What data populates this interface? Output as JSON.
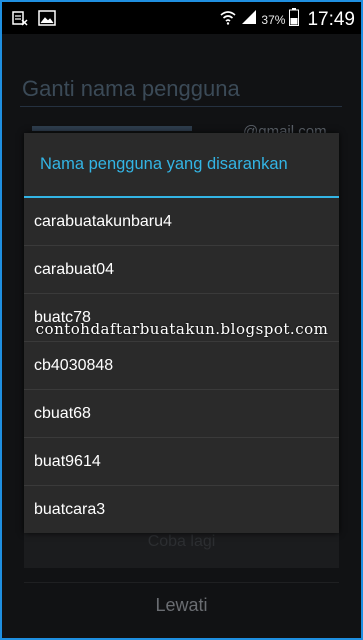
{
  "status_bar": {
    "icons_left": [
      "sms-blocked-icon",
      "image-icon"
    ],
    "icons_right": [
      "wifi-icon",
      "signal-icon",
      "battery-icon"
    ],
    "battery_percent": "37%",
    "time": "17:49"
  },
  "background": {
    "title": "Ganti nama pengguna",
    "email_suffix": "@gmail.com",
    "hidden_button_label": "Coba lagi",
    "skip_label": "Lewati"
  },
  "dialog": {
    "title": "Nama pengguna yang disarankan",
    "suggestions": [
      "carabuatakunbaru4",
      "carabuat04",
      "buatc78",
      "cb4030848",
      "cbuat68",
      "buat9614",
      "buatcara3"
    ]
  },
  "watermark": "contohdaftarbuatakun.blogspot.com",
  "colors": {
    "accent": "#33b5e5",
    "dialog_bg": "#2a2a2a",
    "border": "#1f8fe0"
  }
}
